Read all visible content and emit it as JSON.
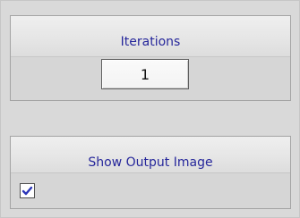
{
  "iterations": {
    "title": "Iterations",
    "value": "1"
  },
  "output": {
    "title": "Show Output Image",
    "checked": true
  },
  "colors": {
    "title": "#26279b",
    "check": "#2b35b8",
    "panel": "#d9d9d9",
    "border": "#a4a4a4"
  },
  "icons": {
    "checkbox_mark": "check-icon"
  }
}
